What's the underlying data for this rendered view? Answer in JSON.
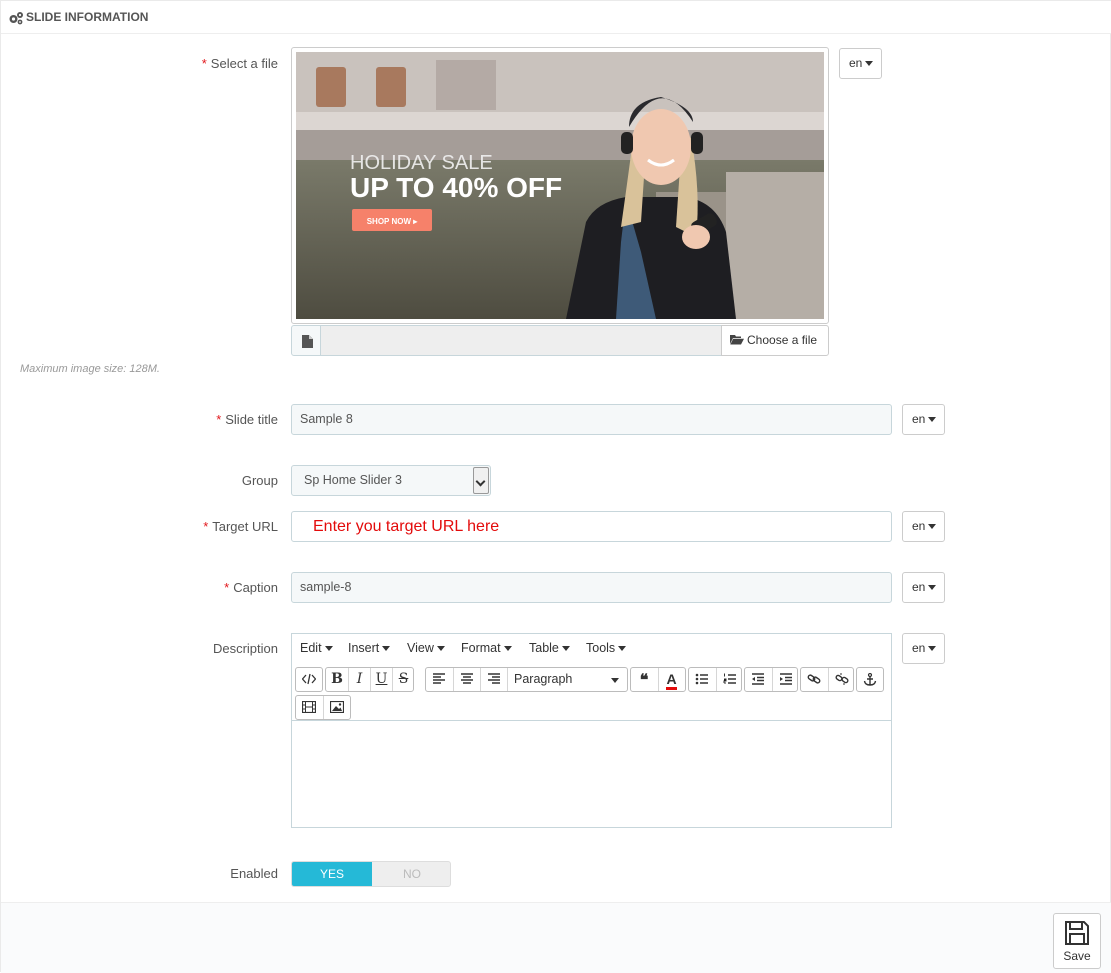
{
  "panel": {
    "title": "SLIDE INFORMATION",
    "icon": "gears-icon"
  },
  "file": {
    "label": "Select a file",
    "language": "en",
    "choose_label": "Choose a file",
    "help": "Maximum image size: 128M.",
    "preview": {
      "headline_small": "HOLIDAY SALE",
      "headline_big": "UP TO 40% OFF",
      "cta": "SHOP NOW ▸"
    }
  },
  "slide_title": {
    "label": "Slide title",
    "value": "Sample 8",
    "language": "en"
  },
  "group": {
    "label": "Group",
    "value": "Sp Home Slider 3"
  },
  "target_url": {
    "label": "Target URL",
    "annotation": "Enter you target URL here",
    "language": "en"
  },
  "caption": {
    "label": "Caption",
    "value": "sample-8",
    "language": "en"
  },
  "description": {
    "label": "Description",
    "language": "en",
    "menu": [
      "Edit",
      "Insert",
      "View",
      "Format",
      "Table",
      "Tools"
    ],
    "format_select": "Paragraph"
  },
  "enabled": {
    "label": "Enabled",
    "yes": "YES",
    "no": "NO",
    "value": "YES"
  },
  "footer": {
    "save_label": "Save"
  },
  "colors": {
    "accent": "#25b9d7",
    "required": "#e2161b",
    "annotation": "#e30b0b"
  }
}
